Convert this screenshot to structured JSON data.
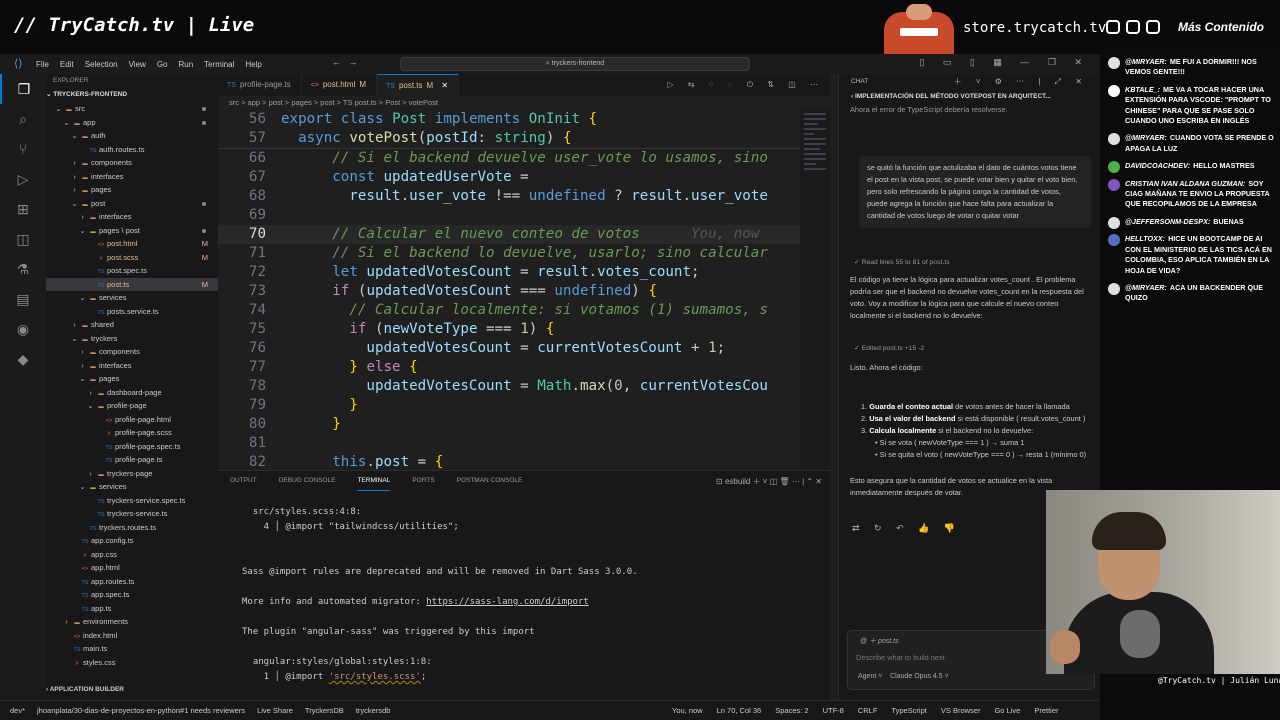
{
  "stream": {
    "title": "// TryCatch.tv | Live",
    "store": "store.trycatch.tv",
    "mas_contenido": "Más Contenido",
    "credit": "@TryCatch.tv | Julián Luna"
  },
  "titlebar": {
    "menus": [
      "File",
      "Edit",
      "Selection",
      "View",
      "Go",
      "Run",
      "Terminal",
      "Help"
    ],
    "search": "tryckers-frontend"
  },
  "explorer": {
    "title": "EXPLORER",
    "root": "TRYCKERS-FRONTEND",
    "footer": "APPLICATION BUILDER",
    "items": [
      {
        "label": "src",
        "indent": 1,
        "kind": "folder-open",
        "dot": true
      },
      {
        "label": "app",
        "indent": 2,
        "kind": "folder-open",
        "dot": true
      },
      {
        "label": "auth",
        "indent": 3,
        "kind": "folder-open"
      },
      {
        "label": "auth.routes.ts",
        "indent": 4,
        "kind": "ts"
      },
      {
        "label": "components",
        "indent": 3,
        "kind": "folder"
      },
      {
        "label": "interfaces",
        "indent": 3,
        "kind": "folder"
      },
      {
        "label": "pages",
        "indent": 3,
        "kind": "folder"
      },
      {
        "label": "post",
        "indent": 3,
        "kind": "folder-open",
        "dot": true
      },
      {
        "label": "interfaces",
        "indent": 4,
        "kind": "folder"
      },
      {
        "label": "pages \\ post",
        "indent": 4,
        "kind": "folder-open",
        "dot": true
      },
      {
        "label": "post.html",
        "indent": 5,
        "kind": "html",
        "mod": "M"
      },
      {
        "label": "post.scss",
        "indent": 5,
        "kind": "scss",
        "mod": "M"
      },
      {
        "label": "post.spec.ts",
        "indent": 5,
        "kind": "ts"
      },
      {
        "label": "post.ts",
        "indent": 5,
        "kind": "ts",
        "mod": "M",
        "selected": true
      },
      {
        "label": "services",
        "indent": 4,
        "kind": "folder-open"
      },
      {
        "label": "posts.service.ts",
        "indent": 5,
        "kind": "ts"
      },
      {
        "label": "shared",
        "indent": 3,
        "kind": "folder"
      },
      {
        "label": "tryckers",
        "indent": 3,
        "kind": "folder-open"
      },
      {
        "label": "components",
        "indent": 4,
        "kind": "folder"
      },
      {
        "label": "interfaces",
        "indent": 4,
        "kind": "folder"
      },
      {
        "label": "pages",
        "indent": 4,
        "kind": "folder-open"
      },
      {
        "label": "dashboard-page",
        "indent": 5,
        "kind": "folder"
      },
      {
        "label": "profile-page",
        "indent": 5,
        "kind": "folder-open"
      },
      {
        "label": "profile-page.html",
        "indent": 6,
        "kind": "html"
      },
      {
        "label": "profile-page.scss",
        "indent": 6,
        "kind": "scss"
      },
      {
        "label": "profile-page.spec.ts",
        "indent": 6,
        "kind": "ts"
      },
      {
        "label": "profile-page.ts",
        "indent": 6,
        "kind": "ts"
      },
      {
        "label": "tryckers-page",
        "indent": 5,
        "kind": "folder"
      },
      {
        "label": "services",
        "indent": 4,
        "kind": "folder-open"
      },
      {
        "label": "tryckers-service.spec.ts",
        "indent": 5,
        "kind": "ts"
      },
      {
        "label": "tryckers-service.ts",
        "indent": 5,
        "kind": "ts"
      },
      {
        "label": "tryckers.routes.ts",
        "indent": 4,
        "kind": "ts"
      },
      {
        "label": "app.config.ts",
        "indent": 3,
        "kind": "ts"
      },
      {
        "label": "app.css",
        "indent": 3,
        "kind": "scss"
      },
      {
        "label": "app.html",
        "indent": 3,
        "kind": "html"
      },
      {
        "label": "app.routes.ts",
        "indent": 3,
        "kind": "ts"
      },
      {
        "label": "app.spec.ts",
        "indent": 3,
        "kind": "ts"
      },
      {
        "label": "app.ts",
        "indent": 3,
        "kind": "ts"
      },
      {
        "label": "environments",
        "indent": 2,
        "kind": "folder"
      },
      {
        "label": "index.html",
        "indent": 2,
        "kind": "html"
      },
      {
        "label": "main.ts",
        "indent": 2,
        "kind": "ts"
      },
      {
        "label": "styles.css",
        "indent": 2,
        "kind": "scss"
      }
    ]
  },
  "tabs": [
    {
      "label": "profile-page.ts",
      "icon": "TS",
      "mod": ""
    },
    {
      "label": "post.html",
      "icon": "<>",
      "mod": "M"
    },
    {
      "label": "post.ts",
      "icon": "TS",
      "mod": "M",
      "active": true
    }
  ],
  "breadcrumbs": "src > app > post > pages > post > TS post.ts > Post > votePost",
  "code": {
    "sticky": [
      {
        "n": "56",
        "html": "<span class=\"kw\">export</span> <span class=\"kw\">class</span> <span class=\"cls\">Post</span> <span class=\"kw\">implements</span> <span class=\"cls\">OnInit</span> <span class=\"punc\">{</span>"
      },
      {
        "n": "57",
        "html": "  <span class=\"kw\">async</span> <span class=\"fn\">votePost</span>(<span class=\"var\">postId</span>: <span class=\"cls\">string</span>) <span class=\"punc\">{</span>"
      }
    ],
    "lines": [
      {
        "n": "66",
        "html": "      <span class=\"cm\">// Si el backend devuelve user_vote lo usamos, sino</span>"
      },
      {
        "n": "67",
        "html": "      <span class=\"kw\">const</span> <span class=\"var\">updatedUserVote</span> ="
      },
      {
        "n": "68",
        "html": "        <span class=\"var\">result</span>.<span class=\"var\">user_vote</span> !== <span class=\"kw\">undefined</span> ? <span class=\"var\">result</span>.<span class=\"var\">user_vote</span>"
      },
      {
        "n": "69",
        "html": ""
      },
      {
        "n": "70",
        "html": "      <span class=\"cm\">// Calcular el nuevo conteo de votos</span>      <span class=\"blame\">You, now</span>",
        "current": true
      },
      {
        "n": "71",
        "html": "      <span class=\"cm\">// Si el backend lo devuelve, usarlo; sino calcular</span>"
      },
      {
        "n": "72",
        "html": "      <span class=\"kw\">let</span> <span class=\"var\">updatedVotesCount</span> = <span class=\"var\">result</span>.<span class=\"var\">votes_count</span>;"
      },
      {
        "n": "73",
        "html": "      <span class=\"kw2\">if</span> (<span class=\"var\">updatedVotesCount</span> === <span class=\"kw\">undefined</span>) <span class=\"punc\">{</span>"
      },
      {
        "n": "74",
        "html": "        <span class=\"cm\">// Calcular localmente: si votamos (1) sumamos, s</span>"
      },
      {
        "n": "75",
        "html": "        <span class=\"kw2\">if</span> (<span class=\"var\">newVoteType</span> === <span class=\"num\">1</span>) <span class=\"punc\">{</span>"
      },
      {
        "n": "76",
        "html": "          <span class=\"var\">updatedVotesCount</span> = <span class=\"var\">currentVotesCount</span> + <span class=\"num\">1</span>;"
      },
      {
        "n": "77",
        "html": "        <span class=\"punc\">}</span> <span class=\"kw2\">else</span> <span class=\"punc\">{</span>"
      },
      {
        "n": "78",
        "html": "          <span class=\"var\">updatedVotesCount</span> = <span class=\"cls\">Math</span>.<span class=\"fn\">max</span>(<span class=\"num\">0</span>, <span class=\"var\">currentVotesCou</span>"
      },
      {
        "n": "79",
        "html": "        <span class=\"punc\">}</span>"
      },
      {
        "n": "80",
        "html": "      <span class=\"punc\">}</span>"
      },
      {
        "n": "81",
        "html": ""
      },
      {
        "n": "82",
        "html": "      <span class=\"kw\">this</span>.<span class=\"var\">post</span> = <span class=\"punc\">{</span>"
      }
    ]
  },
  "panel": {
    "tabs": [
      "OUTPUT",
      "DEBUG CONSOLE",
      "TERMINAL",
      "PORTS",
      "POSTMAN CONSOLE"
    ],
    "active": "TERMINAL",
    "shell": "esbuild",
    "terminal": [
      "  src/styles.scss:4:8:",
      "    4 │ @import \"tailwindcss/utilities\";",
      "",
      "",
      "Sass @import rules are deprecated and will be removed in Dart Sass 3.0.0.",
      "",
      "More info and automated migrator: ",
      "",
      "The plugin \"angular-sass\" was triggered by this import",
      "",
      "  angular:styles/global:styles:1:8:",
      "    1 │ @import "
    ],
    "link": "https://sass-lang.com/d/import",
    "import_str": "'src/styles.scss'",
    "import_tail": ";"
  },
  "status": {
    "left": [
      "dev*",
      "jhoanplata/30-dias-de-proyectos-en-python#1 needs reviewers",
      "Live Share",
      "TryckersDB",
      "tryckersdb"
    ],
    "right": [
      "You, now",
      "Ln 70, Col 36",
      "Spaces: 2",
      "UTF-8",
      "CRLF",
      "TypeScript",
      "VS Browser",
      "Go Live",
      "Prettier"
    ]
  },
  "chat": {
    "header": "CHAT",
    "subheader": "IMPLEMENTACIÓN DEL MÉTODO VOTEPOST EN ARQUITECT...",
    "prev_tail": "Ahora el error de TypeScript debería resolverse.",
    "user_msg": "se quitó la función que actulizaba el dato de cuántos votos tiene el post en la vista post, se puede votar bien y quitar el voto bien, pero solo refrescando la página carga la cantidad de votos, puede agrega la función que hace falta para actualizar la cantidad de votos luego de votar o quitar votar",
    "tool_read": "Read lines 55 to 81 of post.ts",
    "reply1": "El código ya tiene la lógica para actualizar  votes_count . El problema podría ser que el backend no devuelve  votes_count  en la respuesta del voto. Voy a modificar la lógica para que calcule el nuevo conteo localmente si el backend no lo devuelve:",
    "tool_edit": "Edited  post.ts +15 -2",
    "reply2": "Listo. Ahora el código:",
    "list": [
      {
        "n": "1.",
        "bold": "Guarda el conteo actual",
        "text": " de votos antes de hacer la llamada"
      },
      {
        "n": "2.",
        "bold": "Usa el valor del backend",
        "text": " si está disponible ( result.votes_count )"
      },
      {
        "n": "3.",
        "bold": "Calcula localmente",
        "text": " si el backend no lo devuelve:"
      }
    ],
    "sub1": "• Si se vota ( newVoteType === 1 ) → suma 1",
    "sub2": "• Si se quita el voto ( newVoteType === 0 ) → resta 1 (mínimo 0)",
    "reply3": "Esto asegura que la cantidad de votos se actualice en la vista inmediatamente después de votar.",
    "input_file": "post.ts",
    "input_placeholder": "Describe what to build next",
    "agent": "Agent ˅",
    "model": "Claude Opus 4.5 ˅"
  },
  "twitch": [
    {
      "user": "@MIRYAER:",
      "msg": "ME FUI A DORMIR!!! NOS VEMOS GENTE!!!",
      "color": "#e0e0e0"
    },
    {
      "user": "KBTALE_:",
      "msg": "ME VA A TOCAR HACER UNA EXTENSIÓN PARA VSCODE: \"PROMPT TO CHINESE\" PARA QUE SE PASE SOLO CUANDO UNO ESCRIBA EN INGLÉS",
      "color": "#ffffff"
    },
    {
      "user": "@MIRYAER:",
      "msg": "CUANDO VOTA SE PRENDE O APAGA LA LUZ",
      "color": "#e0e0e0"
    },
    {
      "user": "DAVIDCOACHDEV:",
      "msg": "HELLO MASTRES",
      "color": "#4caf50"
    },
    {
      "user": "CRISTIAN IVAN ALDANA GUZMAN:",
      "msg": "SOY CIAG MAÑANA TE ENVIO LA PROPUESTA QUE RECOPILAMOS DE LA EMPRESA",
      "color": "#7e57c2"
    },
    {
      "user": "@JEFFERSONM-DESPX:",
      "msg": "BUENAS",
      "color": "#e0e0e0"
    },
    {
      "user": "HELLTOXX:",
      "msg": "HICE UN BOOTCAMP DE AI CON EL MINISTERIO DE LAS TICS ACÁ EN COLOMBIA, ESO APLICA TAMBIÉN EN LA HOJA DE VIDA?",
      "color": "#5c6bc0"
    },
    {
      "user": "@MIRYAER:",
      "msg": "ACA UN BACKENDER QUE QUIZO",
      "color": "#e0e0e0"
    }
  ],
  "colors": {
    "accent": "#0078d4",
    "modified": "#e2c08d",
    "editor_bg": "#1f1f1f"
  }
}
